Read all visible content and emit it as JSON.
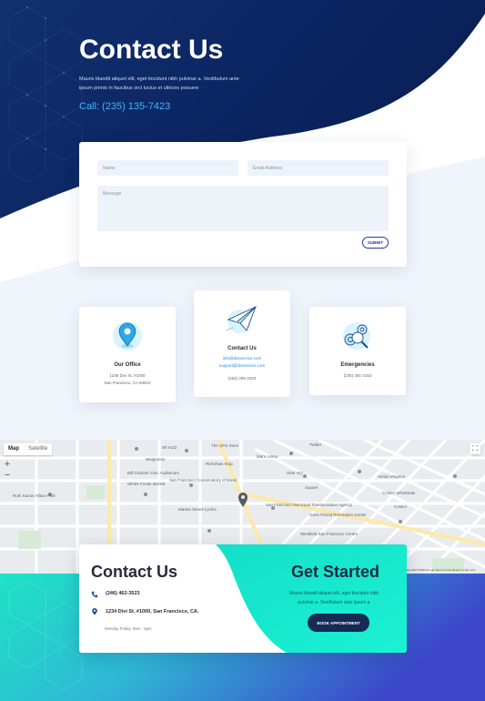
{
  "hero": {
    "title": "Contact Us",
    "text": "Mauris blandit aliquet elit, eget tincidunt nibh pulvinar a. Vestibulum ante ipsum primis in faucibus orci luctus et ultrices posuere",
    "call": "Call: (235) 135-7423"
  },
  "form": {
    "name_placeholder": "Name",
    "email_placeholder": "Email Address",
    "message_placeholder": "Message",
    "submit_label": "SUBMIT"
  },
  "cards": {
    "office": {
      "title": "Our Office",
      "line1": "1235 Divi St. #1000",
      "line2": "San Francisco, CA 93510",
      "icon": "location-pin-icon"
    },
    "contact": {
      "title": "Contact Us",
      "email1": "info@diviservice.com",
      "email2": "support@diviservice.com",
      "phone": "(252) 256-3153",
      "icon": "paper-plane-icon"
    },
    "emergencies": {
      "title": "Emergencies",
      "phone": "(235) 361-3153",
      "icon": "gears-magnifier-icon"
    }
  },
  "map": {
    "type_map": "Map",
    "type_satellite": "Satellite",
    "zoom_in": "+",
    "zoom_out": "−",
    "credit": "Map data ©2020 Google   Terms of Use   Report a map error",
    "labels": [
      "SFJAZZ",
      "Walgreens",
      "Whole Foods Market",
      "The UPS Store",
      "Rickshaw Stop",
      "Bill Graham Civic Auditorium",
      "San Francisco Conservatory of Music",
      "Mars Arena",
      "Twitter",
      "Ruth Kazan Alfaro Park",
      "Costco Wholesale",
      "Uber HQ",
      "Square",
      "San Francisco Municipal Transportation Agency",
      "Market Street Cycles",
      "Gene Friend Recreation Center",
      "Aerial Artspace",
      "Costco",
      "Westfield San Francisco Centre"
    ]
  },
  "contact_card": {
    "title": "Contact Us",
    "phone": "(246) 462-3523",
    "address": "1234 Divi St. #1000, San Francisco, CA.",
    "hours": "Monday-Friday: 8am - 5pm"
  },
  "cta": {
    "title": "Get Started",
    "text": "Mauris blandit aliquet elit, eget tincidunt nibh pulvinar a. Vestibulum ante ipsum p",
    "button": "BOOK APPOINTMENT"
  },
  "colors": {
    "navy": "#0b2a66",
    "accent_blue": "#3fb7ff",
    "teal": "#1de9c9",
    "purple": "#3b3fc9",
    "button_dark": "#152a55"
  }
}
